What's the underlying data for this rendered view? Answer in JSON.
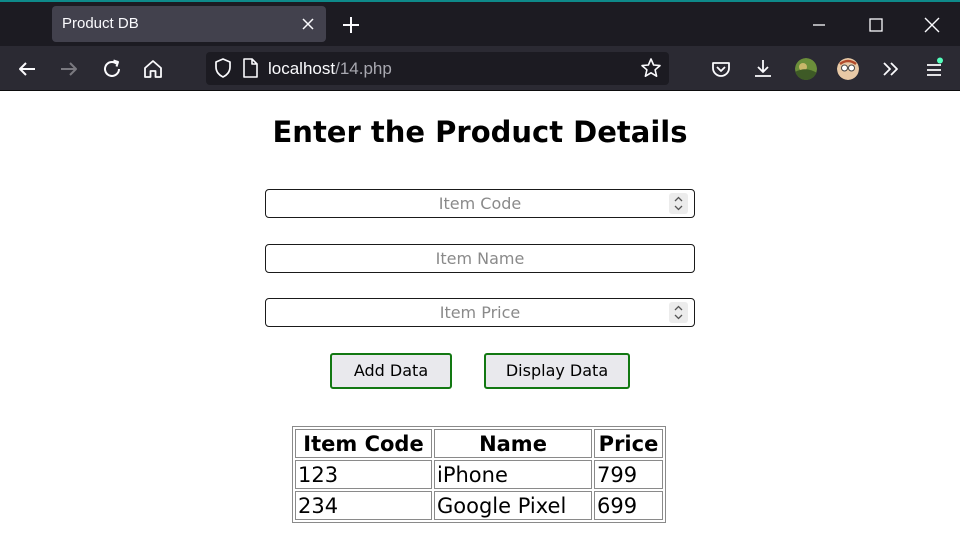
{
  "browser": {
    "tab_title": "Product DB",
    "url_host": "localhost",
    "url_path": "/14.php",
    "accent_color": "#0e8a8a",
    "icons": [
      "close-icon",
      "plus-icon",
      "minimize-icon",
      "maximize-icon",
      "window-close-icon",
      "back-icon",
      "forward-icon",
      "reload-icon",
      "home-icon",
      "shield-icon",
      "page-icon",
      "star-icon",
      "pocket-icon",
      "download-icon",
      "extension-avatar-icon",
      "profile-avatar-icon",
      "overflow-chevrons-icon",
      "menu-icon"
    ]
  },
  "page": {
    "heading": "Enter the Product Details",
    "inputs": {
      "item_code_placeholder": "Item Code",
      "item_name_placeholder": "Item Name",
      "item_price_placeholder": "Item Price"
    },
    "buttons": {
      "add": "Add Data",
      "display": "Display Data"
    },
    "button_border_color": "#127812",
    "table": {
      "headers": [
        "Item Code",
        "Name",
        "Price"
      ],
      "rows": [
        [
          "123",
          "iPhone",
          "799"
        ],
        [
          "234",
          "Google Pixel",
          "699"
        ]
      ]
    }
  }
}
